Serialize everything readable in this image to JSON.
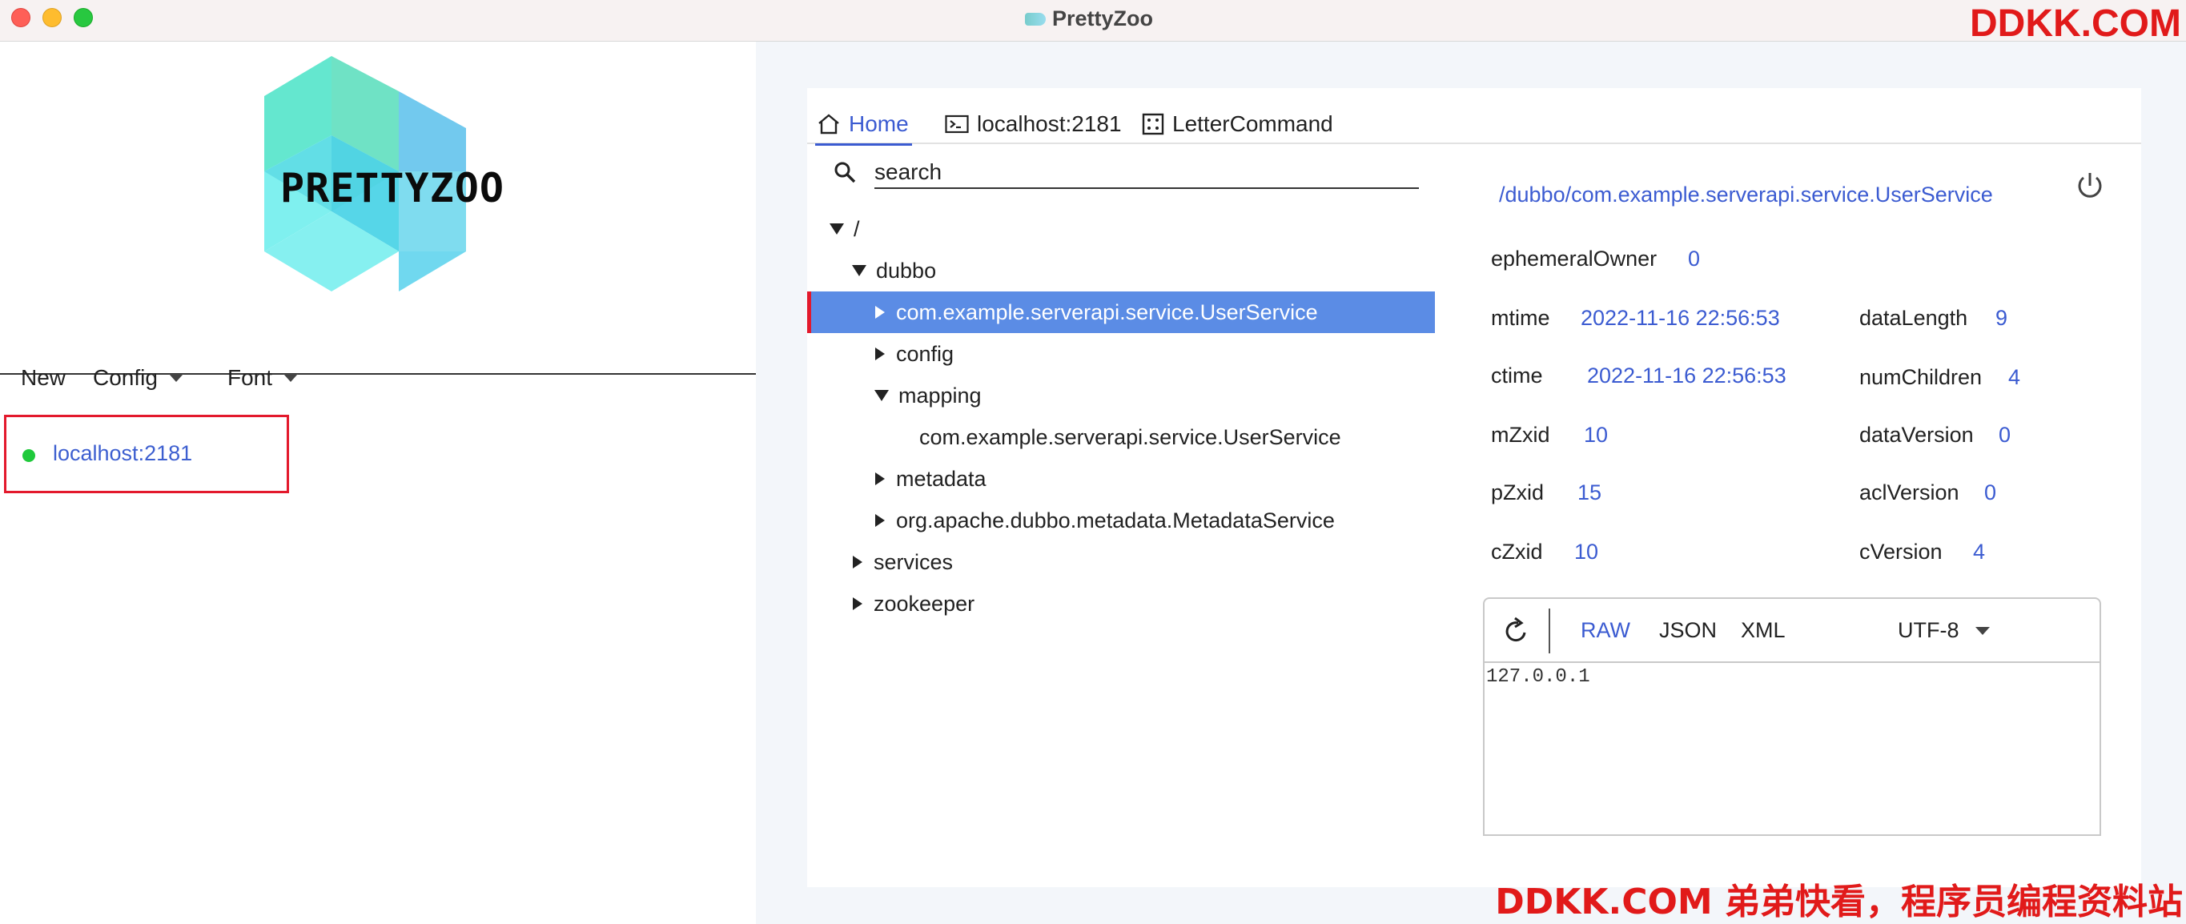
{
  "window": {
    "title": "PrettyZoo"
  },
  "watermark": {
    "top": "DDKK.COM",
    "bottom": "DDKK.COM 弟弟快看，程序员编程资料站"
  },
  "logo": {
    "text": "PRETTYZOO"
  },
  "left_menu": {
    "new": "New",
    "config": "Config",
    "font": "Font"
  },
  "servers": [
    {
      "label": "localhost:2181",
      "status_color": "#1fc93b"
    }
  ],
  "tabs": [
    {
      "label": "Home",
      "icon": "home-icon"
    },
    {
      "label": "localhost:2181",
      "icon": "terminal-icon"
    },
    {
      "label": "LetterCommand",
      "icon": "command-icon"
    }
  ],
  "search": {
    "placeholder": "search"
  },
  "tree": [
    {
      "label": "/",
      "expanded": true
    },
    {
      "label": "dubbo",
      "expanded": true
    },
    {
      "label": "com.example.serverapi.service.UserService",
      "selected": true
    },
    {
      "label": "config"
    },
    {
      "label": "mapping",
      "expanded": true
    },
    {
      "label": "com.example.serverapi.service.UserService"
    },
    {
      "label": "metadata"
    },
    {
      "label": "org.apache.dubbo.metadata.MetadataService"
    },
    {
      "label": "services"
    },
    {
      "label": "zookeeper"
    }
  ],
  "detail": {
    "path": "/dubbo/com.example.serverapi.service.UserService",
    "ephemeralOwner": {
      "label": "ephemeralOwner",
      "value": "0"
    },
    "mtime": {
      "label": "mtime",
      "value": "2022-11-16 22:56:53"
    },
    "ctime": {
      "label": "ctime",
      "value": "2022-11-16 22:56:53"
    },
    "mZxid": {
      "label": "mZxid",
      "value": "10"
    },
    "pZxid": {
      "label": "pZxid",
      "value": "15"
    },
    "cZxid": {
      "label": "cZxid",
      "value": "10"
    },
    "dataLength": {
      "label": "dataLength",
      "value": "9"
    },
    "numChildren": {
      "label": "numChildren",
      "value": "4"
    },
    "dataVersion": {
      "label": "dataVersion",
      "value": "0"
    },
    "aclVersion": {
      "label": "aclVersion",
      "value": "0"
    },
    "cVersion": {
      "label": "cVersion",
      "value": "4"
    }
  },
  "viewer": {
    "formats": [
      "RAW",
      "JSON",
      "XML"
    ],
    "active_format": "RAW",
    "encoding": "UTF-8",
    "content": "127.0.0.1"
  },
  "colors": {
    "accent": "#3b5bd1",
    "selected_row": "#5b8ce5",
    "highlight_box": "#e3192c"
  }
}
